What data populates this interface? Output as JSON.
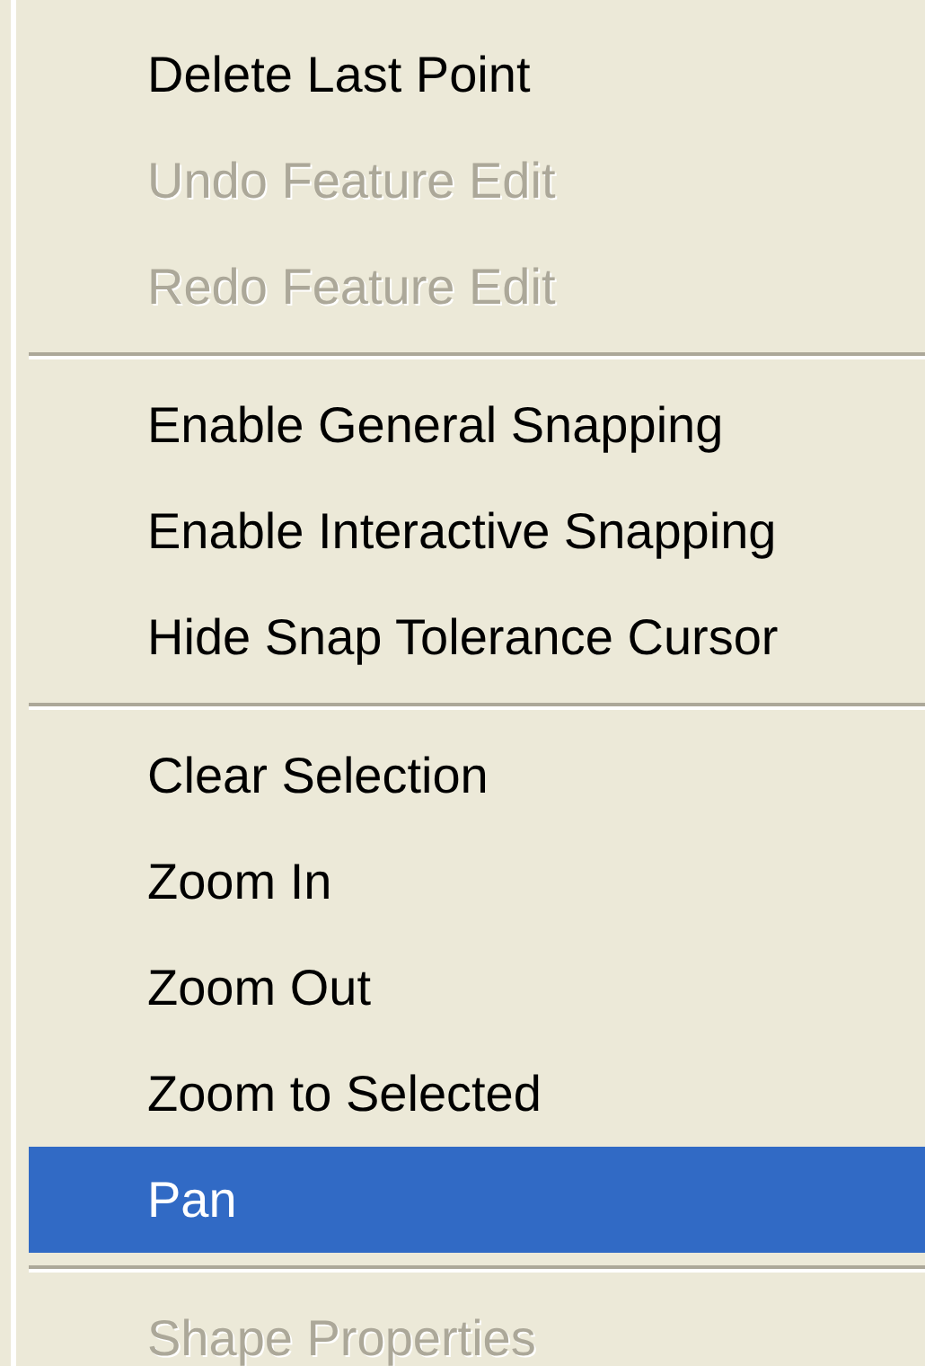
{
  "menu": {
    "entries": [
      {
        "kind": "item",
        "label": "Delete Last Point",
        "disabled": false,
        "selected": false
      },
      {
        "kind": "item",
        "label": "Undo Feature Edit",
        "disabled": true,
        "selected": false
      },
      {
        "kind": "item",
        "label": "Redo Feature Edit",
        "disabled": true,
        "selected": false
      },
      {
        "kind": "separator"
      },
      {
        "kind": "item",
        "label": "Enable General Snapping",
        "disabled": false,
        "selected": false
      },
      {
        "kind": "item",
        "label": "Enable Interactive Snapping",
        "disabled": false,
        "selected": false
      },
      {
        "kind": "item",
        "label": "Hide Snap Tolerance Cursor",
        "disabled": false,
        "selected": false
      },
      {
        "kind": "separator"
      },
      {
        "kind": "item",
        "label": "Clear Selection",
        "disabled": false,
        "selected": false
      },
      {
        "kind": "item",
        "label": "Zoom In",
        "disabled": false,
        "selected": false
      },
      {
        "kind": "item",
        "label": "Zoom Out",
        "disabled": false,
        "selected": false
      },
      {
        "kind": "item",
        "label": "Zoom to Selected",
        "disabled": false,
        "selected": false
      },
      {
        "kind": "item",
        "label": "Pan",
        "disabled": false,
        "selected": true
      },
      {
        "kind": "separator"
      },
      {
        "kind": "item",
        "label": "Shape Properties",
        "disabled": true,
        "selected": false
      }
    ]
  }
}
